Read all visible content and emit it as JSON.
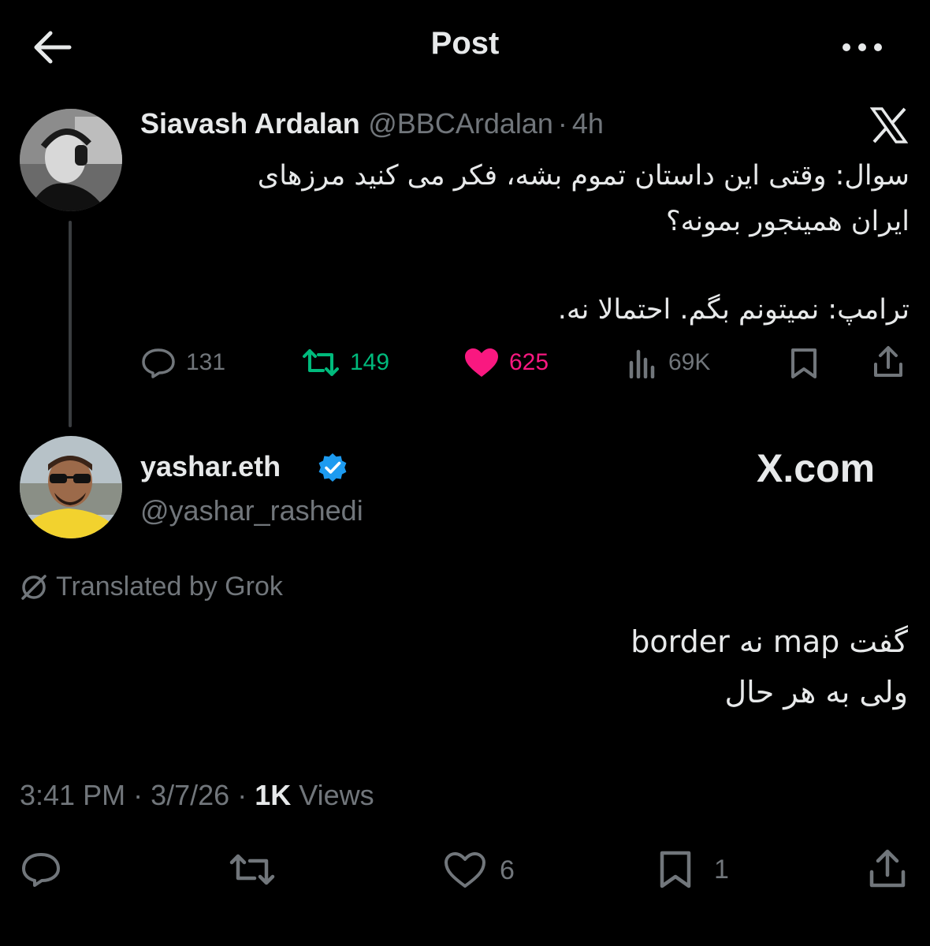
{
  "header": {
    "title": "Post"
  },
  "quoted_post": {
    "display_name": "Siavash Ardalan",
    "handle": "@BBCArdalan",
    "separator": "·",
    "age": "4h",
    "body_lines": [
      "سوال: وقتی این داستان تموم بشه، فکر می کنید مرزهای",
      "ایران همینجور بمونه؟",
      "ترامپ: نمیتونم بگم. احتمالا نه."
    ],
    "replies": "131",
    "reposts": "149",
    "likes": "625",
    "views": "69K",
    "colors": {
      "repost": "#00ba7c",
      "like": "#f91880"
    }
  },
  "post": {
    "display_name": "yashar.eth",
    "handle": "@yashar_rashedi",
    "verified": true,
    "watermark": "X.com",
    "translated_label": "Translated by Grok",
    "body_lines": [
      "گفت map نه border",
      "ولی به هر حال"
    ],
    "time": "3:41 PM",
    "dot1": "·",
    "date": "3/7/26",
    "dot2": "·",
    "views_count": "1K",
    "views_label": "Views",
    "likes": "6",
    "bookmarks": "1"
  },
  "icons": [
    "back-arrow-icon",
    "more-icon",
    "x-logo-icon",
    "reply-icon",
    "repost-icon",
    "heart-icon",
    "views-icon",
    "bookmark-icon",
    "share-icon",
    "verified-badge-icon",
    "translate-icon"
  ]
}
